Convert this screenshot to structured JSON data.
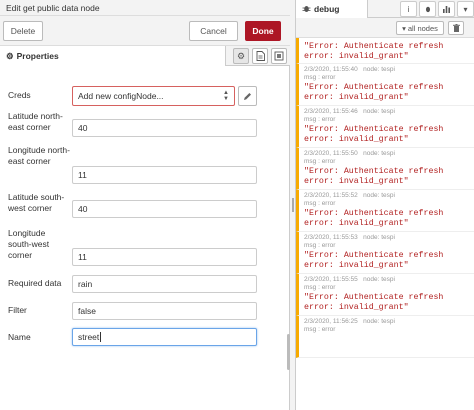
{
  "tray": {
    "title": "Edit get public data node",
    "delete_label": "Delete",
    "cancel_label": "Cancel",
    "done_label": "Done",
    "tab_label": "Properties"
  },
  "form": {
    "creds_label": "Creds",
    "creds_value": "Add new configNode...",
    "lat_ne_label": "Latitude north-east corner",
    "lat_ne_value": "40",
    "lon_ne_label": "Longitude north-east corner",
    "lon_ne_value": "11",
    "lat_sw_label": "Latitude south-west corner",
    "lat_sw_value": "40",
    "lon_sw_label": "Longitude south-west corner",
    "lon_sw_value": "11",
    "required_label": "Required data",
    "required_value": "rain",
    "filter_label": "Filter",
    "filter_value": "false",
    "name_label": "Name",
    "name_value": "street"
  },
  "sidebar": {
    "tab_label": "debug",
    "filter_label": "all nodes",
    "topic_prefix": "msg : error",
    "messages": [
      {
        "body": "\"Error: Authenticate refresh error: invalid_grant\""
      },
      {
        "time": "2/3/2020, 11:55:40",
        "node": "node: tespi",
        "topic": "msg : error",
        "body": "\"Error: Authenticate refresh error: invalid_grant\""
      },
      {
        "time": "2/3/2020, 11:55:46",
        "node": "node: tespi",
        "topic": "msg : error",
        "body": "\"Error: Authenticate refresh error: invalid_grant\""
      },
      {
        "time": "2/3/2020, 11:55:50",
        "node": "node: tespi",
        "topic": "msg : error",
        "body": "\"Error: Authenticate refresh error: invalid_grant\""
      },
      {
        "time": "2/3/2020, 11:55:52",
        "node": "node: tespi",
        "topic": "msg : error",
        "body": "\"Error: Authenticate refresh error: invalid_grant\""
      },
      {
        "time": "2/3/2020, 11:55:53",
        "node": "node: tespi",
        "topic": "msg : error",
        "body": "\"Error: Authenticate refresh error: invalid_grant\""
      },
      {
        "time": "2/3/2020, 11:55:55",
        "node": "node: tespi",
        "topic": "msg : error",
        "body": "\"Error: Authenticate refresh error: invalid_grant\""
      },
      {
        "time": "2/3/2020, 11:56:25",
        "node": "node: tespi",
        "topic": "msg : error",
        "body": ""
      }
    ]
  },
  "colors": {
    "done": "#ad1625",
    "error_text": "#b22222",
    "msg_marker": "#f7aa00"
  }
}
